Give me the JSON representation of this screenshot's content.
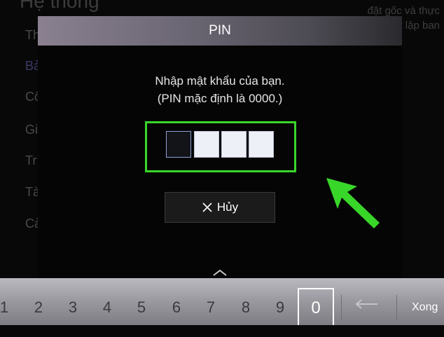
{
  "background": {
    "title": "Hệ thống",
    "menu_items": [
      "Thời gian",
      "Bả",
      "Cô",
      "Gi",
      "Tr",
      "Tà",
      "Cả"
    ],
    "description_lines": [
      "đặt gốc và thực",
      "ết lập ban"
    ]
  },
  "dialog": {
    "title": "PIN",
    "instruction_line1": "Nhập mật khẩu của bạn.",
    "instruction_line2": "(PIN mặc định là 0000.)",
    "pin_digits": [
      "",
      "",
      "",
      ""
    ],
    "active_digit_index": 0,
    "cancel_label": "Hủy"
  },
  "keypad": {
    "keys": [
      "1",
      "2",
      "3",
      "4",
      "5",
      "6",
      "7",
      "8",
      "9"
    ],
    "selected_key": "0",
    "done_label": "Xong"
  },
  "colors": {
    "highlight_green": "#39d62a",
    "keypad_bar": "#a8a8ae"
  },
  "icons": {
    "cancel": "close-icon",
    "keypad_back": "backspace-arrow-icon",
    "scroll_up": "chevron-up-icon",
    "annotation": "green-arrow-icon"
  }
}
